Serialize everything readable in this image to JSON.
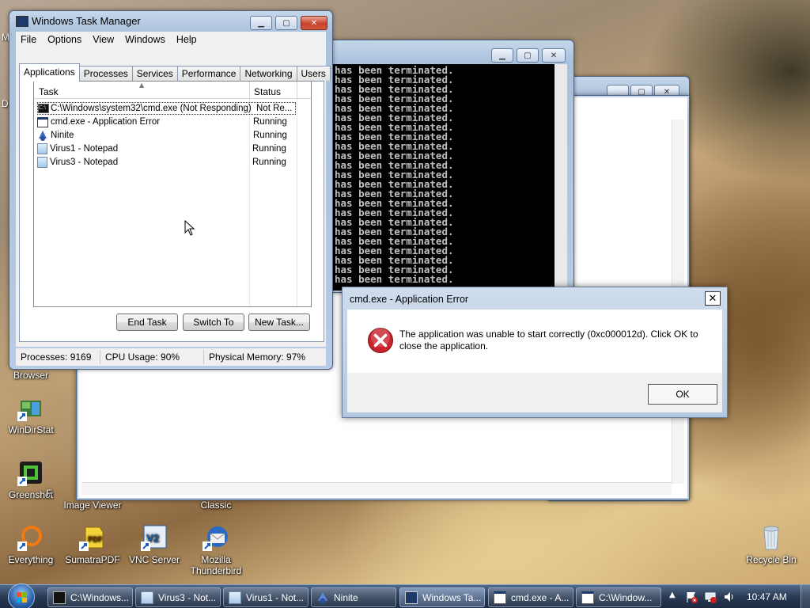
{
  "desktop": {
    "icons": [
      {
        "label": "Browser",
        "partial": true
      },
      {
        "label": "WinDirStat"
      },
      {
        "label": "Greenshot"
      },
      {
        "label": "Image Viewer"
      },
      {
        "label": "Classic"
      },
      {
        "label": "Everything"
      },
      {
        "label": "SumatraPDF"
      },
      {
        "label": "VNC Server"
      },
      {
        "label": "Mozilla Thunderbird"
      },
      {
        "label": "Recycle Bin"
      }
    ],
    "edge_letters": [
      "M",
      "D",
      "F"
    ]
  },
  "taskmgr": {
    "title": "Windows Task Manager",
    "menu": [
      "File",
      "Options",
      "View",
      "Windows",
      "Help"
    ],
    "tabs": [
      "Applications",
      "Processes",
      "Services",
      "Performance",
      "Networking",
      "Users"
    ],
    "columns": {
      "task": "Task",
      "status": "Status"
    },
    "rows": [
      {
        "task": "C:\\Windows\\system32\\cmd.exe (Not Responding)",
        "status": "Not Re...",
        "icon": "console-icon"
      },
      {
        "task": "cmd.exe - Application Error",
        "status": "Running",
        "icon": "window-icon"
      },
      {
        "task": "Ninite",
        "status": "Running",
        "icon": "ninite-icon"
      },
      {
        "task": "Virus1 - Notepad",
        "status": "Running",
        "icon": "notepad-icon"
      },
      {
        "task": "Virus3 - Notepad",
        "status": "Running",
        "icon": "notepad-icon"
      }
    ],
    "buttons": {
      "end_task": "End Task",
      "switch_to": "Switch To",
      "new_task": "New Task..."
    },
    "status": {
      "processes": "Processes: 9169",
      "cpu": "CPU Usage: 90%",
      "memory": "Physical Memory: 97%"
    }
  },
  "console": {
    "lines": [
      "has been terminated.",
      "has been terminated.",
      "has been terminated.",
      "has been terminated.",
      "has been terminated.",
      "has been terminated.",
      "has been terminated.",
      "has been terminated.",
      "has been terminated.",
      "has been terminated.",
      "has been terminated.",
      "has been terminated.",
      "has been terminated.",
      "has been terminated.",
      "has been terminated.",
      "has been terminated.",
      "has been terminated.",
      "has been terminated.",
      "has been terminated.",
      "has been terminated.",
      "has been terminated.",
      "has been terminated.",
      "has been terminated."
    ]
  },
  "error_dialog": {
    "title": "cmd.exe - Application Error",
    "message": "The application was unable to start correctly (0xc000012d). Click OK to close the application.",
    "ok": "OK"
  },
  "taskbar": {
    "items": [
      {
        "label": "C:\\Windows...",
        "icon": "console-icon"
      },
      {
        "label": "Virus3 - Not...",
        "icon": "notepad-icon"
      },
      {
        "label": "Virus1 - Not...",
        "icon": "notepad-icon"
      },
      {
        "label": "Ninite",
        "icon": "ninite-icon"
      },
      {
        "label": "Windows Ta...",
        "icon": "taskmgr-icon"
      },
      {
        "label": "cmd.exe - A...",
        "icon": "window-icon"
      },
      {
        "label": "C:\\Window...",
        "icon": "window-icon"
      }
    ],
    "clock": "10:47 AM"
  },
  "colors": {
    "error_red": "#c8232c",
    "titlebar_blue": "#b7cbe2",
    "console_bg": "#000000"
  }
}
